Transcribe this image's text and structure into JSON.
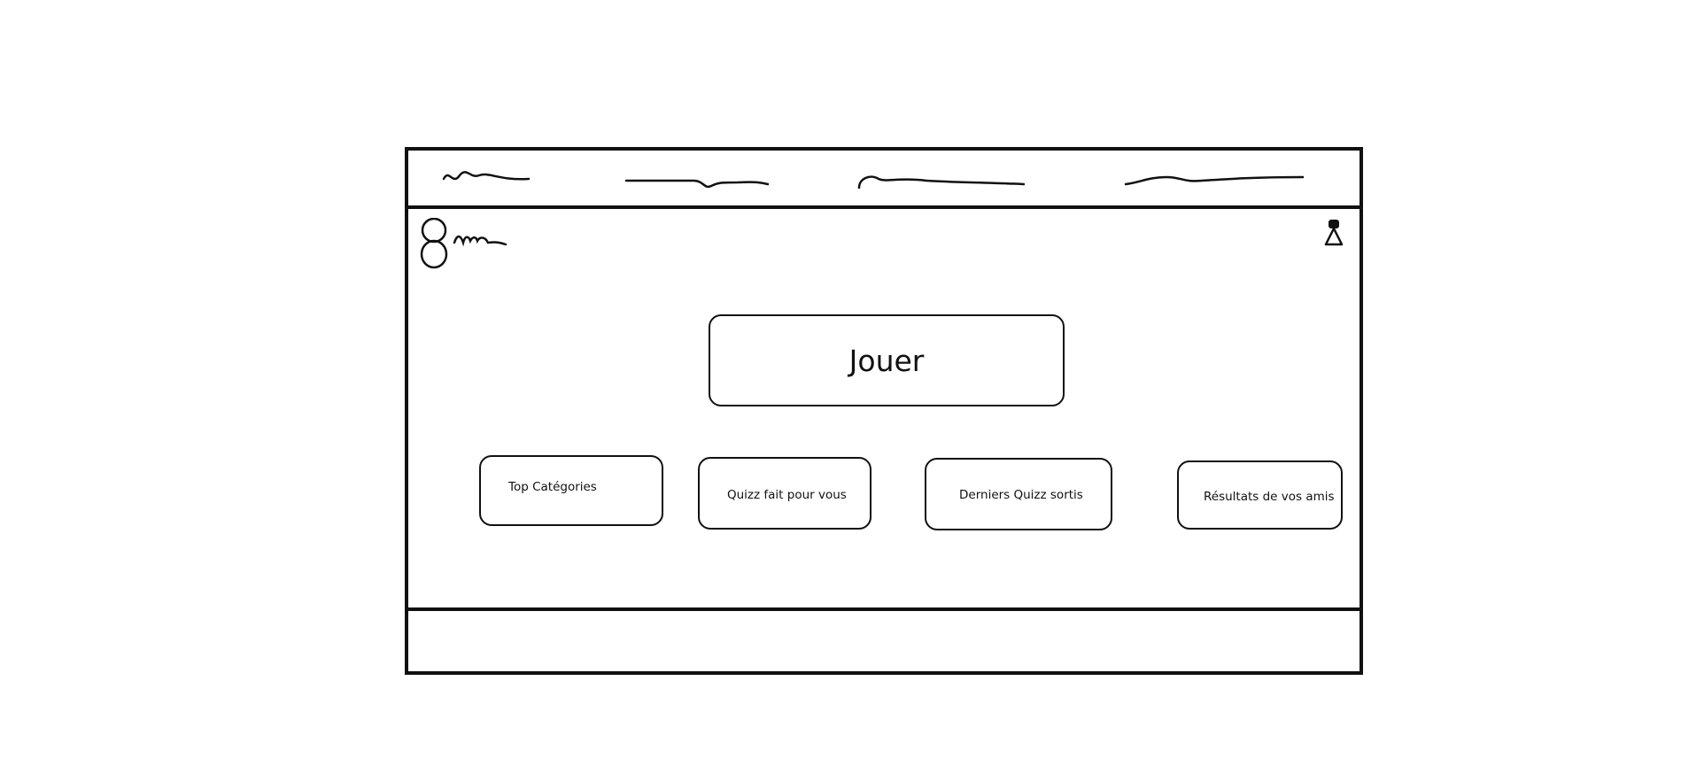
{
  "header": {
    "nav_scribbles": [
      "nav-item-1",
      "nav-item-2",
      "nav-item-3",
      "nav-item-4"
    ]
  },
  "logo": {
    "icon": "logo-mark-icon"
  },
  "user": {
    "icon": "user-icon"
  },
  "main": {
    "play_label": "Jouer",
    "tiles": [
      {
        "label": "Top Catégories"
      },
      {
        "label": "Quizz fait pour vous"
      },
      {
        "label": "Derniers Quizz sortis"
      },
      {
        "label": "Résultats de vos amis"
      }
    ]
  },
  "colors": {
    "stroke": "#111111",
    "background": "#ffffff"
  }
}
